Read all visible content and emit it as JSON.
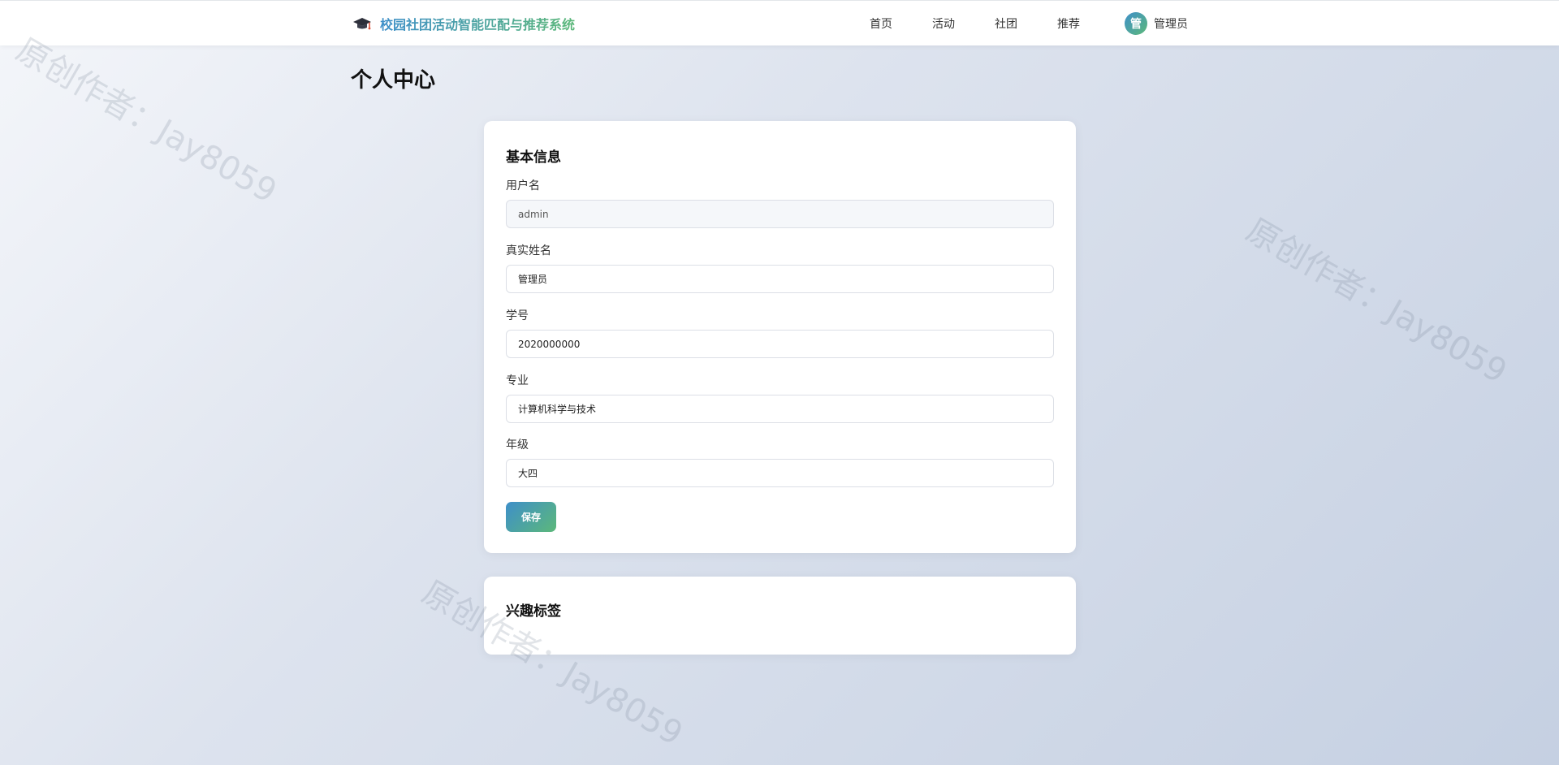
{
  "header": {
    "brand_icon": "graduation-cap-icon",
    "brand_title": "校园社团活动智能匹配与推荐系统",
    "nav": [
      {
        "label": "首页"
      },
      {
        "label": "活动"
      },
      {
        "label": "社团"
      },
      {
        "label": "推荐"
      }
    ],
    "user": {
      "avatar_char": "管",
      "name": "管理员"
    }
  },
  "page": {
    "title": "个人中心"
  },
  "basic_info": {
    "title": "基本信息",
    "fields": [
      {
        "label": "用户名",
        "value": "admin",
        "readonly": true
      },
      {
        "label": "真实姓名",
        "value": "管理员"
      },
      {
        "label": "学号",
        "value": "2020000000"
      },
      {
        "label": "专业",
        "value": "计算机科学与技术"
      },
      {
        "label": "年级",
        "value": "大四"
      }
    ],
    "save_label": "保存"
  },
  "interest_tags": {
    "title": "兴趣标签"
  },
  "watermark": {
    "text": "原创作者：Jay8059"
  },
  "colors": {
    "accent_start": "#3e8fc9",
    "accent_end": "#5cb87a"
  }
}
